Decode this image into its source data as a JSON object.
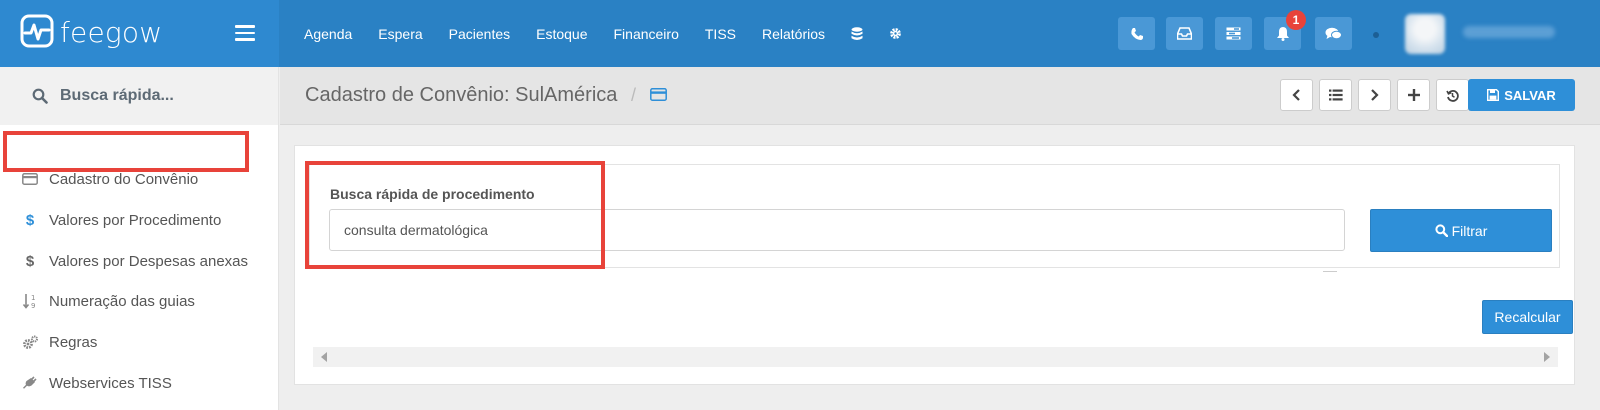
{
  "brand": {
    "name": "feegow"
  },
  "topnav": {
    "items": [
      "Agenda",
      "Espera",
      "Pacientes",
      "Estoque",
      "Financeiro",
      "TISS",
      "Relatórios"
    ],
    "notification_count": "1"
  },
  "sidebar": {
    "quick_search": "Busca rápida...",
    "items": [
      {
        "label": "Cadastro do Convênio",
        "icon": "credit-card-icon"
      },
      {
        "label": "Valores por Procedimento",
        "icon": "dollar-icon"
      },
      {
        "label": "Valores por Despesas anexas",
        "icon": "dollar-icon"
      },
      {
        "label": "Numeração das guias",
        "icon": "sort-numeric-icon"
      },
      {
        "label": "Regras",
        "icon": "cogs-icon"
      },
      {
        "label": "Webservices TISS",
        "icon": "plug-icon"
      }
    ]
  },
  "header": {
    "title": "Cadastro de Convênio: SulAmérica",
    "separator": "/",
    "save_label": "SALVAR"
  },
  "filter": {
    "label": "Busca rápida de procedimento",
    "value": "consulta dermatológica",
    "button_label": "Filtrar"
  },
  "actions": {
    "recalc_label": "Recalcular"
  },
  "colors": {
    "topbar": "#2a81c4",
    "brand_bg": "#2e89d0",
    "primary_button": "#2e8fd8",
    "highlight": "#e8433a",
    "badge": "#e8433a"
  }
}
